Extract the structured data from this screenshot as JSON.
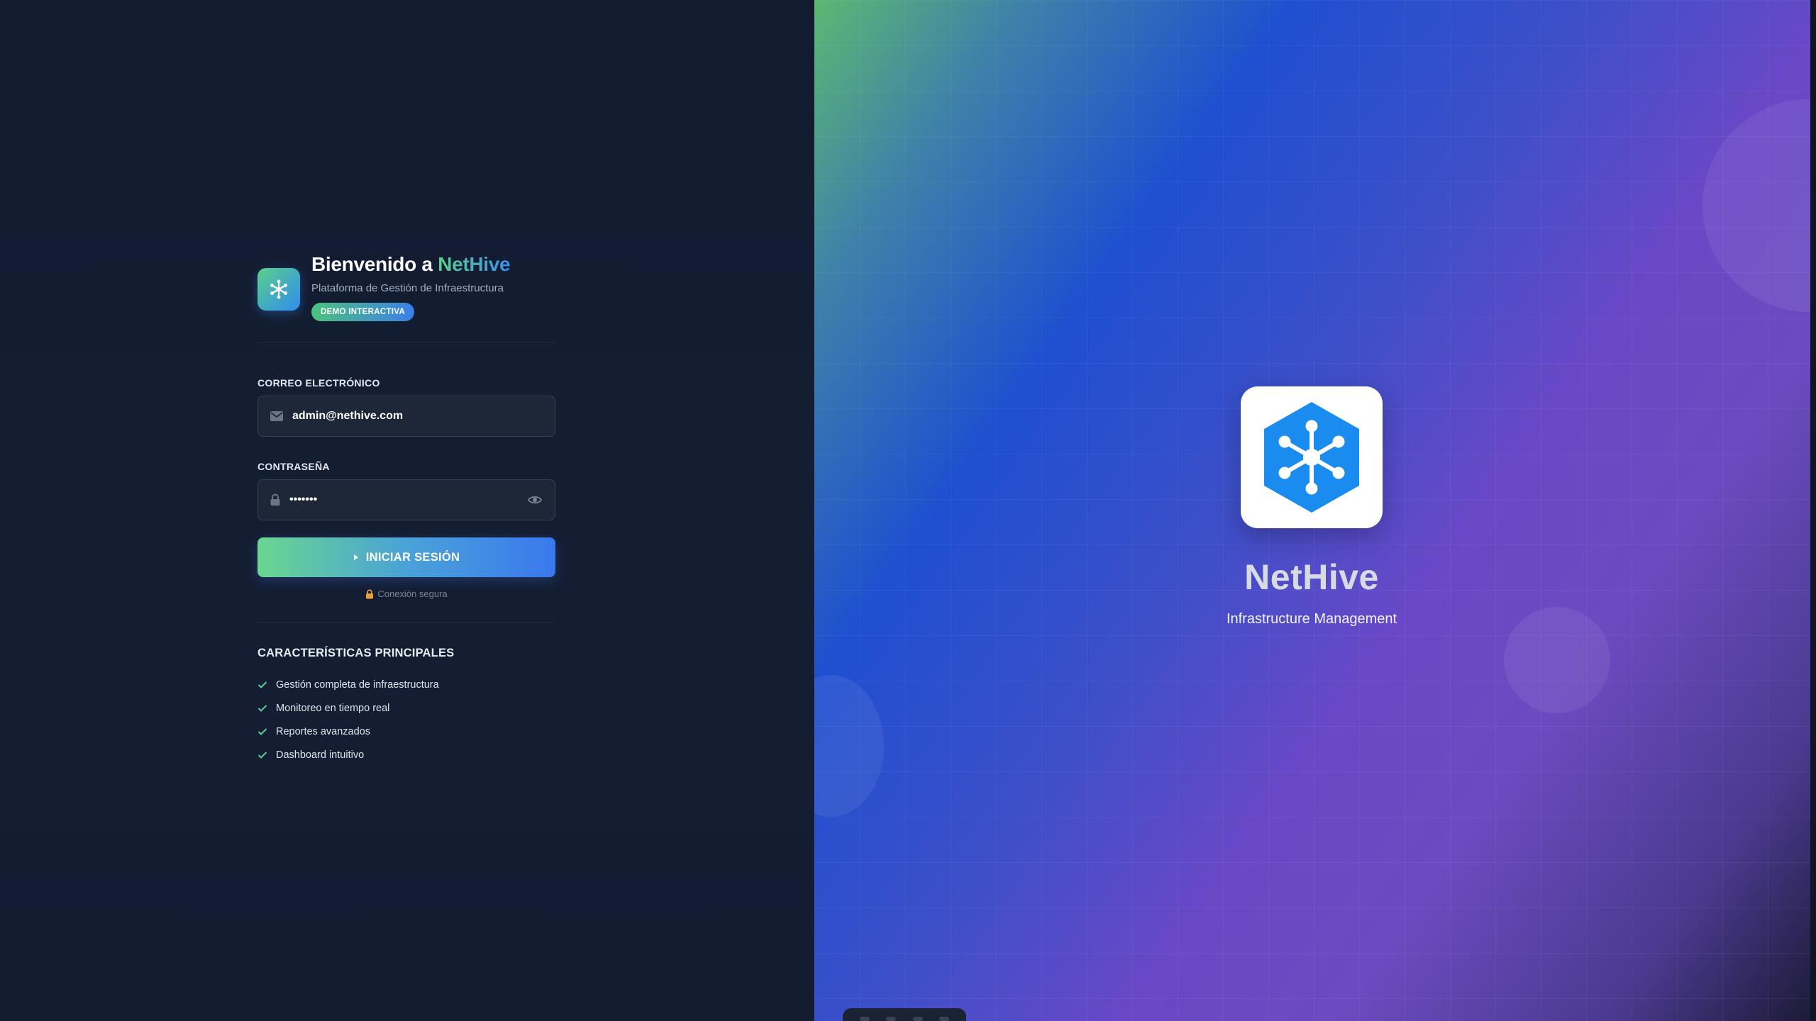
{
  "login": {
    "title_prefix": "Bienvenido a ",
    "title_brand": "NetHive",
    "subtitle": "Plataforma de Gestión de Infraestructura",
    "badge": "DEMO INTERACTIVA",
    "email_label": "CORREO ELECTRÓNICO",
    "email_value": "admin@nethive.com",
    "password_label": "CONTRASEÑA",
    "password_value": "•••••••",
    "submit_label": "INICIAR SESIÓN",
    "secure_text": "Conexión segura"
  },
  "features": {
    "title": "CARACTERÍSTICAS PRINCIPALES",
    "items": [
      "Gestión completa de infraestructura",
      "Monitoreo en tiempo real",
      "Reportes avanzados",
      "Dashboard intuitivo"
    ]
  },
  "hero": {
    "name": "NetHive",
    "tagline": "Infrastructure Management"
  },
  "colors": {
    "accent_green": "#5bd08a",
    "accent_blue": "#3a78ee",
    "panel_bg": "#121b30",
    "logo_blue": "#1a8cf0"
  },
  "icons": [
    "hive-logo-icon",
    "mail-icon",
    "lock-icon",
    "eye-icon",
    "play-icon",
    "padlock-icon",
    "check-icon"
  ]
}
